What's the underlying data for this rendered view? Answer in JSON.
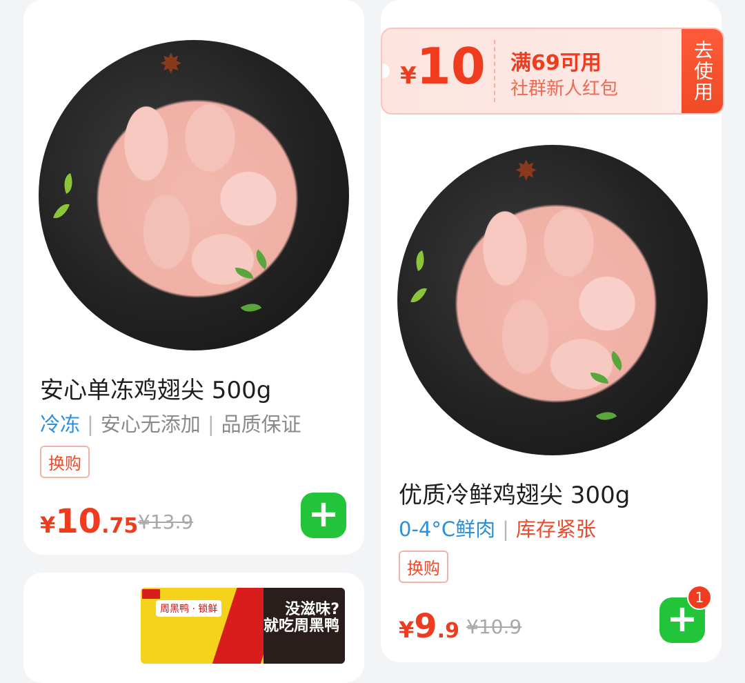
{
  "coupon": {
    "currency": "¥",
    "amount": "10",
    "condition": "满69可用",
    "description": "社群新人红包",
    "use_label": "去使用"
  },
  "products": [
    {
      "title": "安心单冻鸡翅尖 500g",
      "tags": [
        "冷冻",
        "安心无添加",
        "品质保证"
      ],
      "badge": "换购",
      "price_currency": "¥",
      "price_int": "10",
      "price_dec": ".75",
      "original_price": "¥13.9",
      "add_icon": "plus-icon"
    },
    {
      "title": "优质冷鲜鸡翅尖 300g",
      "tags": [
        "0-4°C鲜肉",
        "库存紧张"
      ],
      "badge": "换购",
      "price_currency": "¥",
      "price_int": "9",
      "price_dec": ".9",
      "original_price": "¥10.9",
      "add_icon": "plus-icon",
      "cart_count": "1"
    }
  ],
  "third_product": {
    "slogan_line1": "没滋味?",
    "slogan_line2": "就吃周黑鸭"
  },
  "colors": {
    "price_red": "#ef3b1e",
    "add_green": "#22c53a",
    "tag_blue": "#2a8fdc"
  }
}
